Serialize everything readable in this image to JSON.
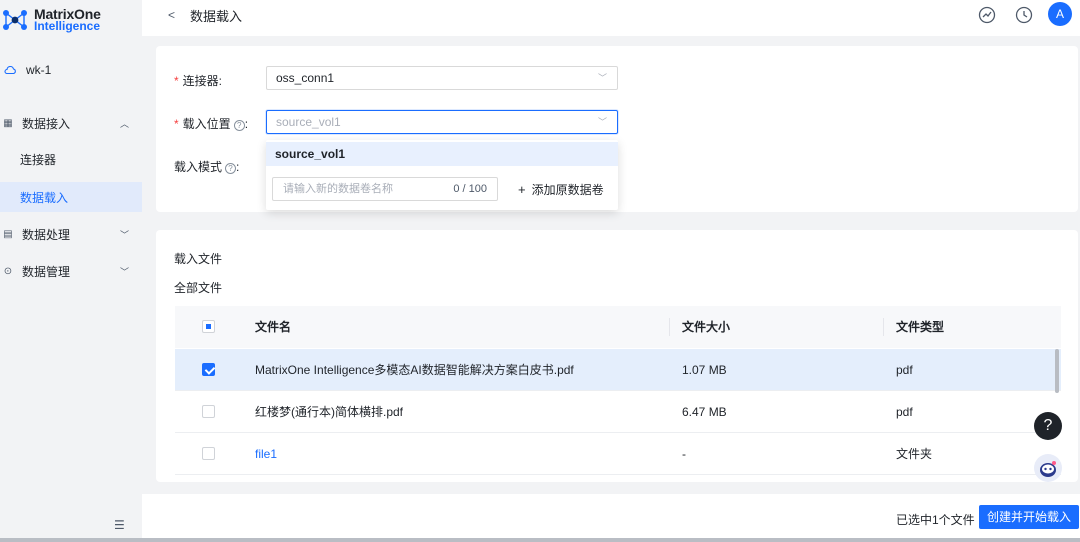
{
  "logo": {
    "line1": "MatrixOne",
    "line2": "Intelligence",
    "brand_color": "#1a6dff"
  },
  "workspace": {
    "name": "wk-1",
    "icon": "cloud-icon"
  },
  "sidebar": {
    "groups": [
      {
        "label": "数据接入",
        "icon": "grid-icon",
        "expanded": true,
        "items": [
          {
            "label": "连接器"
          },
          {
            "label": "数据载入",
            "active": true
          }
        ]
      },
      {
        "label": "数据处理",
        "icon": "list-icon",
        "expanded": false
      },
      {
        "label": "数据管理",
        "icon": "check-circle-icon",
        "expanded": false
      }
    ],
    "collapse_icon": "collapse-menu-icon"
  },
  "header": {
    "back_glyph": "<",
    "title": "数据载入",
    "icons": [
      "dashboard-icon",
      "history-icon"
    ],
    "avatar_letter": "A"
  },
  "form": {
    "connector": {
      "label": "连接器:",
      "value": "oss_conn1",
      "required": true
    },
    "location": {
      "label": "载入位置",
      "help": "?",
      "colon": ":",
      "value": "source_vol1",
      "required": true
    },
    "mode": {
      "label": "载入模式",
      "help": "?",
      "colon": ":"
    }
  },
  "dropdown": {
    "options": [
      "source_vol1"
    ],
    "new_volume_placeholder": "请输入新的数据卷名称",
    "char_count": "0 / 100",
    "add_label": "添加原数据卷",
    "add_glyph": "+"
  },
  "files": {
    "section_title": "载入文件",
    "subtitle": "全部文件",
    "columns": [
      "文件名",
      "文件大小",
      "文件类型"
    ],
    "rows": [
      {
        "name": "MatrixOne Intelligence多模态AI数据智能解决方案白皮书.pdf",
        "size": "1.07 MB",
        "type": "pdf",
        "checked": true
      },
      {
        "name": "红楼梦(通行本)简体横排.pdf",
        "size": "6.47 MB",
        "type": "pdf",
        "checked": false
      },
      {
        "name": "file1",
        "size": "-",
        "type": "文件夹",
        "checked": false,
        "is_link": true
      }
    ]
  },
  "fabs": {
    "help": "?",
    "assistant_icon": "robot-assistant-icon"
  },
  "footer": {
    "selection_text": "已选中1个文件",
    "primary_label": "创建并开始载入"
  }
}
